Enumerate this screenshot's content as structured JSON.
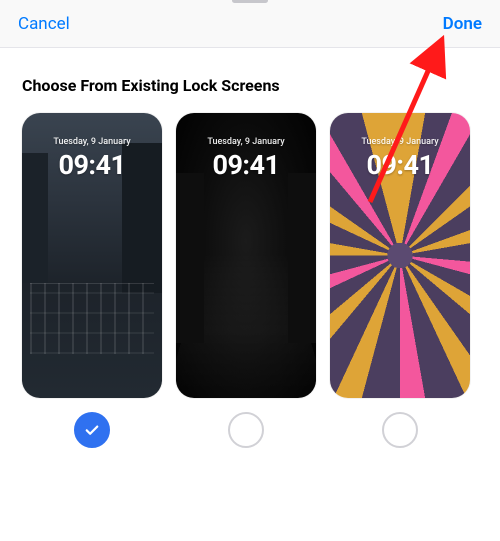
{
  "nav": {
    "cancel_label": "Cancel",
    "done_label": "Done"
  },
  "section_title": "Choose From Existing Lock Screens",
  "lockscreens": [
    {
      "date": "Tuesday, 9 January",
      "time": "09:41",
      "style": "city",
      "selected": true
    },
    {
      "date": "Tuesday, 9 January",
      "time": "09:41",
      "style": "dark",
      "selected": false
    },
    {
      "date": "Tuesday, 9 January",
      "time": "09:41",
      "style": "emoji",
      "selected": false
    }
  ],
  "colors": {
    "tint": "#007aff",
    "selection": "#2f71f0",
    "annotation": "#ff1a1a"
  }
}
